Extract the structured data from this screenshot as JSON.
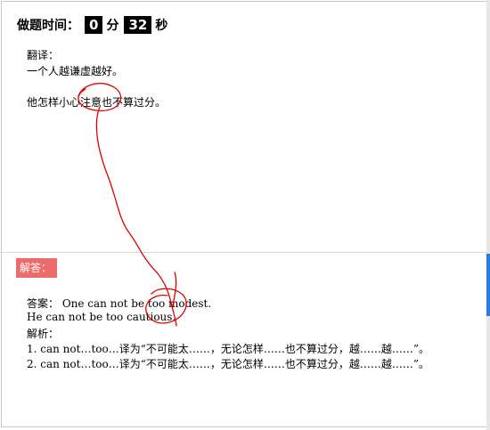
{
  "timer": {
    "label": "做题时间：",
    "minutes": "0",
    "minutes_unit": "分",
    "seconds": "32",
    "seconds_unit": "秒"
  },
  "question": {
    "heading": "翻译：",
    "sentence1": "一个人越谦虚越好。",
    "sentence2": "他怎样小心注意也不算过分。"
  },
  "answer": {
    "tag": "解答：",
    "line1": "答案： One can not be too modest.",
    "line2": "He can not be too cautious.",
    "analysis_heading": "解析：",
    "point1": "1. can not…too…译为“不可能太……，无论怎样……也不算过分，越……越……”。",
    "point2": "2. can not…too…译为“不可能太……，无论怎样……也不算过分，越……越……”。"
  },
  "colors": {
    "tag_bg": "#ee6b6b",
    "timer_box_bg": "#000000",
    "annotation_ink": "#e00000",
    "scroll_thumb": "#2a7fd4"
  }
}
